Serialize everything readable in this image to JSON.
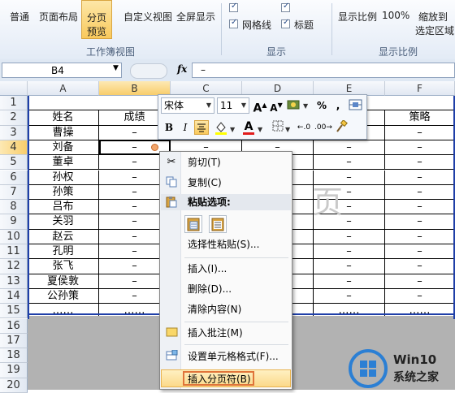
{
  "ribbon": {
    "buttons": {
      "normal": "普通",
      "page_layout": "页面布局",
      "page_break_preview_1": "分页",
      "page_break_preview_2": "预览",
      "custom_view": "自定义视图",
      "full_screen": "全屏显示",
      "gridlines": "网格线",
      "headings": "标题",
      "zoom": "显示比例",
      "zoom_100": "100%",
      "zoom_selection_1": "缩放到",
      "zoom_selection_2": "选定区域"
    },
    "groups": {
      "workbook_views": "工作簿视图",
      "show": "显示",
      "zoom": "显示比例"
    }
  },
  "formula_bar": {
    "name_box": "B4",
    "fx": "fx",
    "content": "–"
  },
  "columns": [
    "A",
    "B",
    "C",
    "D",
    "E",
    "F"
  ],
  "rows": [
    "1",
    "2",
    "3",
    "4",
    "5",
    "6",
    "7",
    "8",
    "9",
    "10",
    "11",
    "12",
    "13",
    "14",
    "15",
    "16",
    "17",
    "18",
    "19",
    "20"
  ],
  "table": {
    "header_a": "姓名",
    "header_b": "成绩",
    "header_f": "策略",
    "names": [
      "曹操",
      "刘备",
      "董卓",
      "孙权",
      "孙策",
      "吕布",
      "关羽",
      "赵云",
      "孔明",
      "张飞",
      "夏侯敦",
      "公孙策"
    ],
    "dash": "–",
    "ellipsis": "……"
  },
  "watermark": "页",
  "mini_toolbar": {
    "font": "宋体",
    "size": "11",
    "bold": "B",
    "italic": "I",
    "percent": "%",
    "comma": ","
  },
  "context_menu": {
    "cut": "剪切(T)",
    "copy": "复制(C)",
    "paste_options": "粘贴选项:",
    "paste_special": "选择性粘贴(S)...",
    "insert": "插入(I)...",
    "delete": "删除(D)...",
    "clear": "清除内容(N)",
    "insert_comment": "插入批注(M)",
    "format_cells": "设置单元格格式(F)...",
    "insert_page_break": "插入分页符(B)"
  },
  "logo": {
    "line1": "Win10",
    "line2": "系统之家"
  },
  "colors": {
    "accent_blue": "#1f3fa8",
    "highlight": "#fbd98a"
  }
}
